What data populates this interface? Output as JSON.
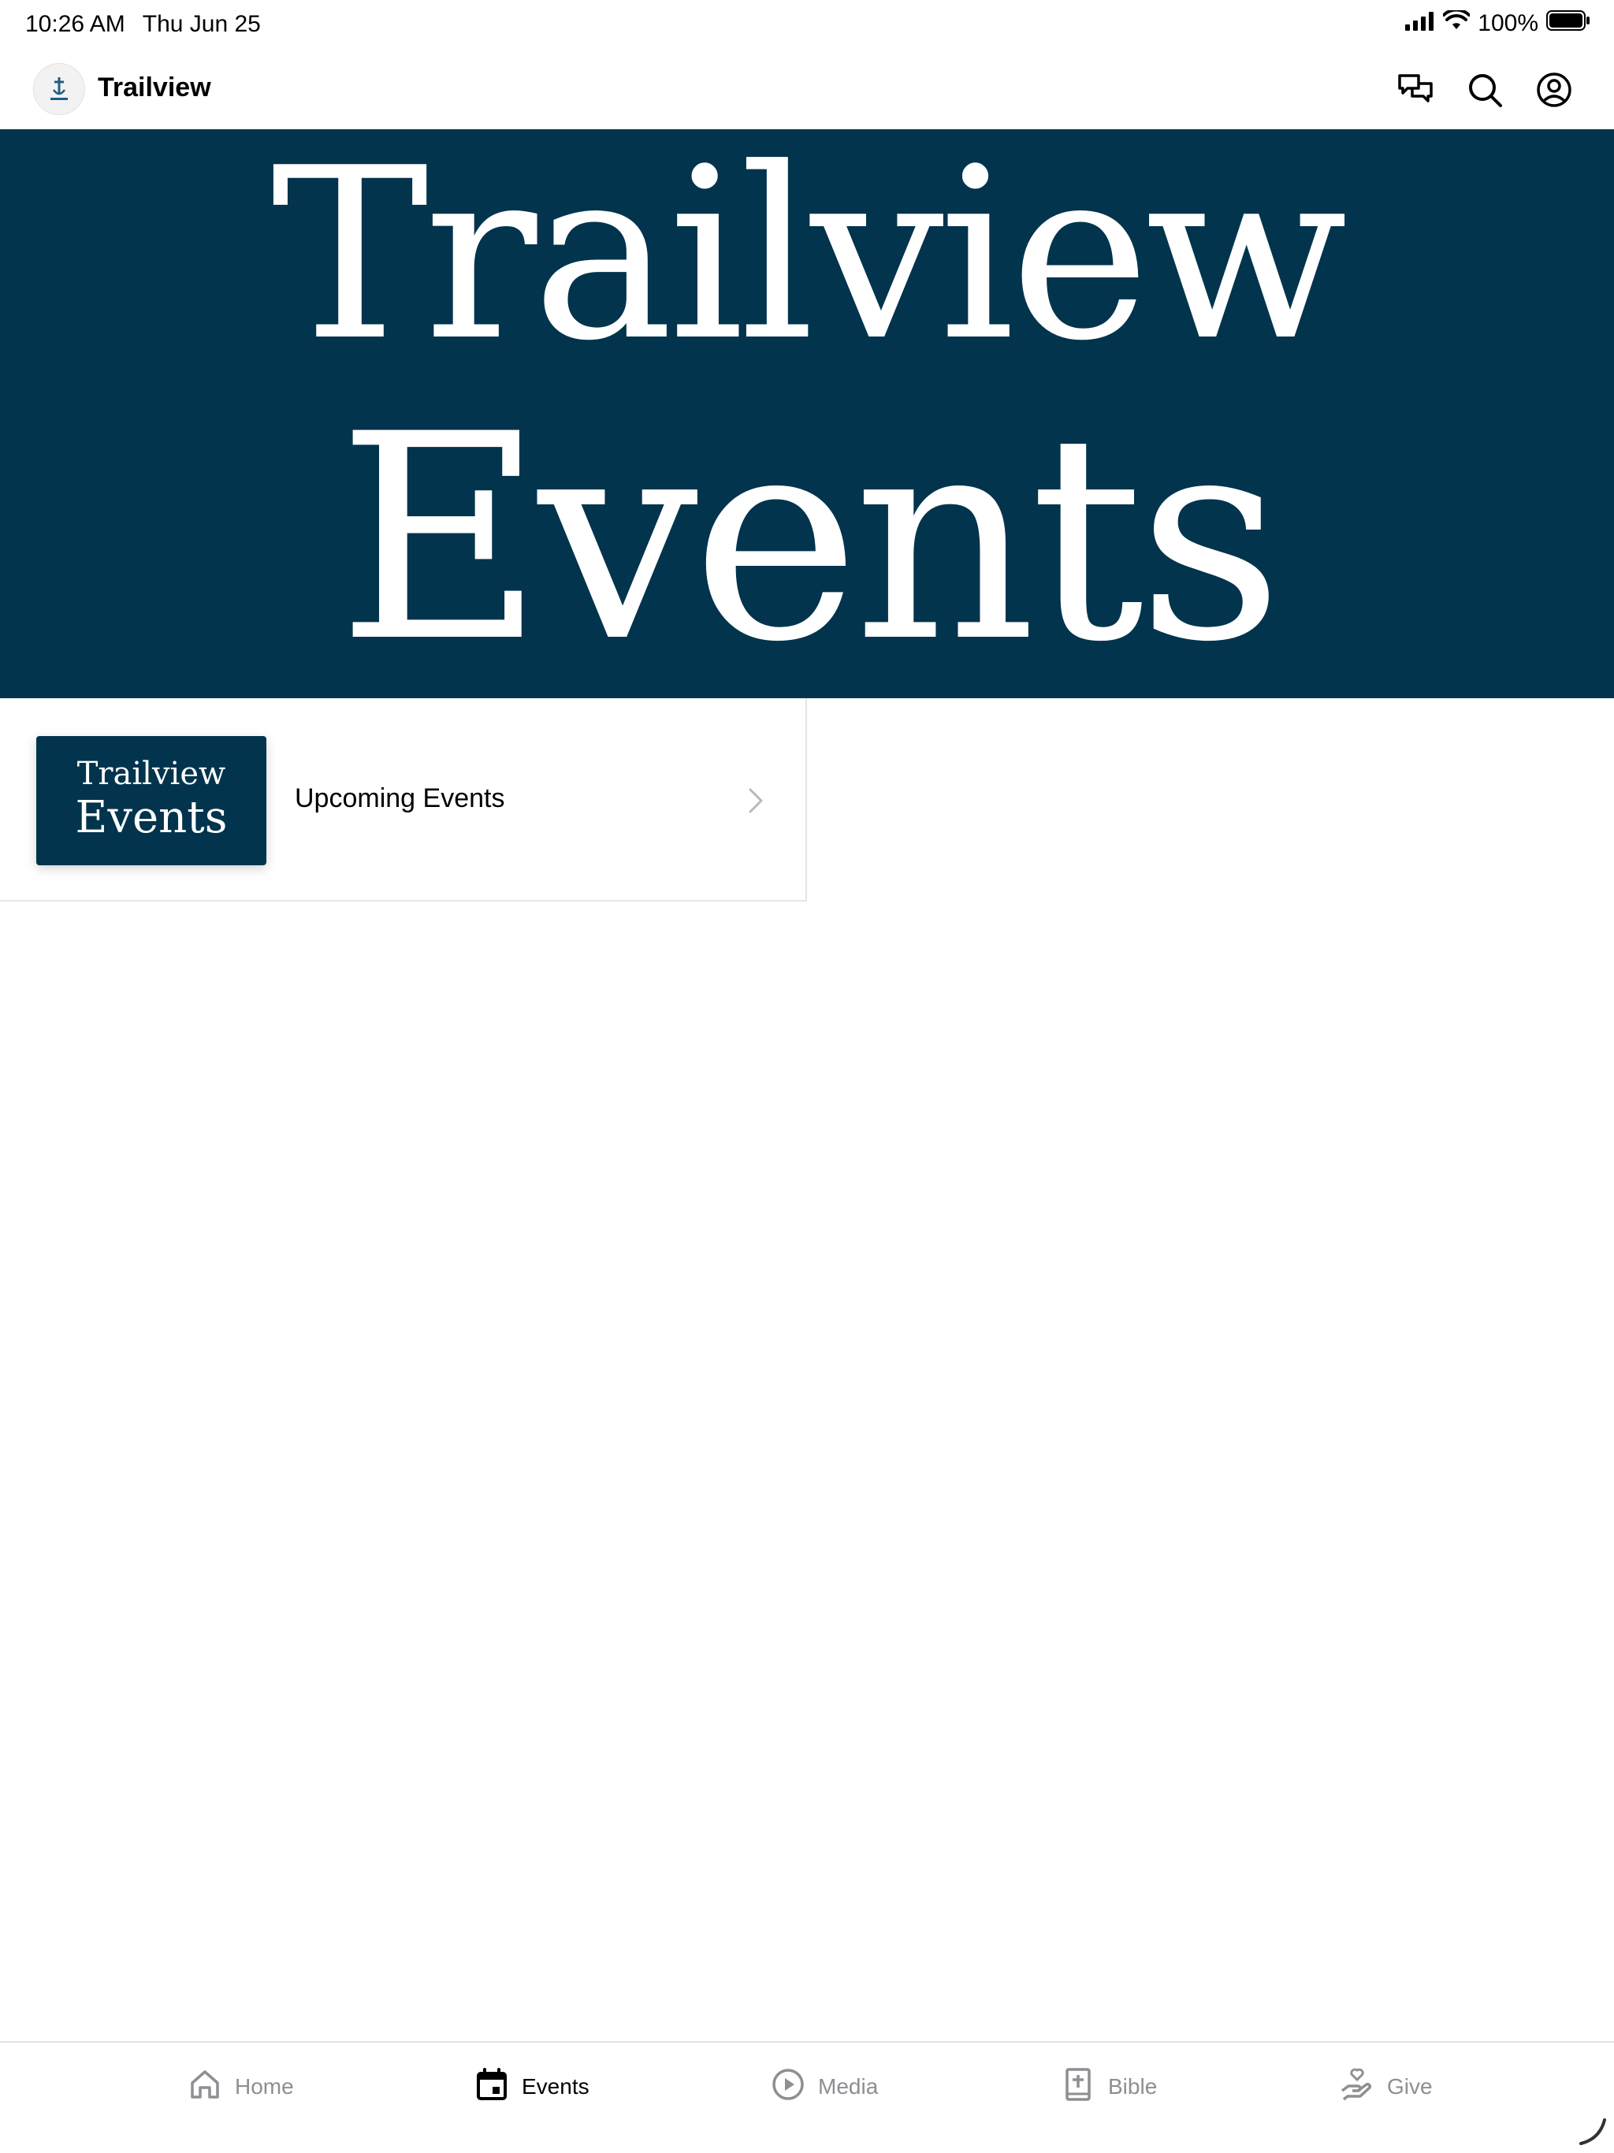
{
  "status_bar": {
    "time": "10:26 AM",
    "date": "Thu Jun 25",
    "battery": "100%"
  },
  "header": {
    "app_title": "Trailview",
    "icons": [
      "chat-icon",
      "search-icon",
      "profile-icon"
    ]
  },
  "hero": {
    "line1": "Trailview",
    "line2": "Events"
  },
  "list": {
    "items": [
      {
        "thumb_line1": "Trailview",
        "thumb_line2": "Events",
        "label": "Upcoming Events"
      }
    ]
  },
  "tabs": [
    {
      "label": "Home",
      "icon": "home-icon",
      "active": false
    },
    {
      "label": "Events",
      "icon": "calendar-icon",
      "active": true
    },
    {
      "label": "Media",
      "icon": "play-icon",
      "active": false
    },
    {
      "label": "Bible",
      "icon": "bible-icon",
      "active": false
    },
    {
      "label": "Give",
      "icon": "give-icon",
      "active": false
    }
  ],
  "colors": {
    "brand_navy": "#02344d",
    "tab_inactive": "#8e8e93",
    "tab_active": "#000000"
  }
}
